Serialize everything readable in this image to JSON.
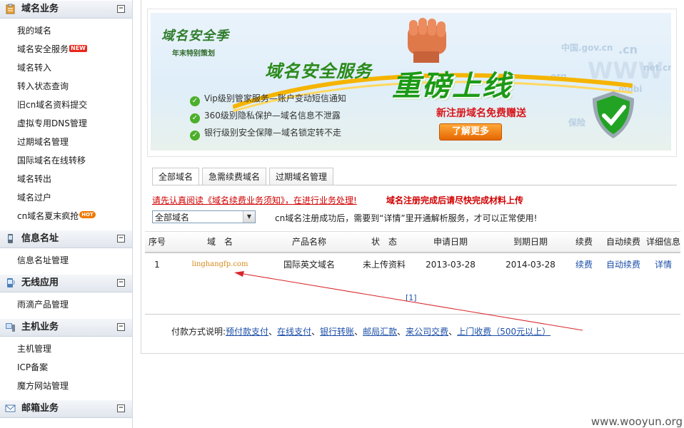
{
  "sidebar": {
    "sections": [
      {
        "title": "域名业务",
        "icon": "domain-clipboard-icon",
        "toggle": "−",
        "items": [
          {
            "label": "我的域名"
          },
          {
            "label": "域名安全服务",
            "badge": "NEW"
          },
          {
            "label": "域名转入"
          },
          {
            "label": "转入状态查询"
          },
          {
            "label": "旧cn域名资料提交"
          },
          {
            "label": "虚拟专用DNS管理"
          },
          {
            "label": "过期域名管理"
          },
          {
            "label": "国际域名在线转移"
          },
          {
            "label": "域名转出"
          },
          {
            "label": "域名过户"
          },
          {
            "label": "cn域名夏末疯抢",
            "badge": "HOT"
          }
        ]
      },
      {
        "title": "信息名址",
        "icon": "phone-icon",
        "toggle": "−",
        "items": [
          {
            "label": "信息名址管理"
          }
        ]
      },
      {
        "title": "无线应用",
        "icon": "mobile-icon",
        "toggle": "−",
        "items": [
          {
            "label": "雨滴产品管理"
          }
        ]
      },
      {
        "title": "主机业务",
        "icon": "server-icon",
        "toggle": "−",
        "items": [
          {
            "label": "主机管理"
          },
          {
            "label": "ICP备案"
          },
          {
            "label": "魔方网站管理"
          }
        ]
      },
      {
        "title": "邮箱业务",
        "icon": "mail-icon",
        "toggle": "−",
        "items": []
      }
    ]
  },
  "banner": {
    "brand": "域名安全季",
    "brand_sub": "年末特别策划",
    "title": "域名安全服务",
    "headline": "重磅上线",
    "features": [
      "Vip级别管家服务—账户变动短信通知",
      "360级别隐私保护—域名信息不泄露",
      "银行级别安全保障—域名锁定转不走"
    ],
    "promo": "新注册域名免费赠送",
    "more_button": "了解更多",
    "bg_words": [
      "中国.gov.cn",
      ".cn",
      "WWW",
      "org",
      "net.cn",
      "mobi",
      "保险"
    ]
  },
  "tabs": [
    {
      "label": "全部域名",
      "active": true
    },
    {
      "label": "急需续费域名",
      "active": false
    },
    {
      "label": "过期域名管理",
      "active": false
    }
  ],
  "notices": {
    "renewal_notice": "请先认真阅读《域名续费业务须知》，在进行业务处理!",
    "upload_notice": "域名注册完成后请尽快完成材料上传"
  },
  "filter": {
    "selected": "全部域名",
    "hint": "cn域名注册成功后，需要到“详情”里开通解析服务，才可以正常使用!"
  },
  "table": {
    "headers": [
      "序号",
      "域　名",
      "产品名称",
      "状　态",
      "申请日期",
      "到期日期",
      "续费",
      "自动续费",
      "详细信息"
    ],
    "rows": [
      {
        "index": "1",
        "domain": "linghangfp.com",
        "product": "国际英文域名",
        "status": "未上传资料",
        "apply_date": "2013-03-28",
        "expire_date": "2014-03-28",
        "renew": "续费",
        "auto_renew": "自动续费",
        "detail": "详情"
      }
    ]
  },
  "pager": "[1]",
  "payment": {
    "label": "付款方式说明:",
    "methods": [
      "预付款支付",
      "在线支付",
      "银行转账",
      "邮局汇款",
      "来公司交费",
      "上门收费（500元以上）"
    ]
  },
  "watermark": "www.wooyun.org",
  "colors": {
    "annotation_arrow": "#d8262b",
    "link": "#1b4ea8",
    "warning": "#d10000",
    "domain_link": "#d78a1b"
  }
}
